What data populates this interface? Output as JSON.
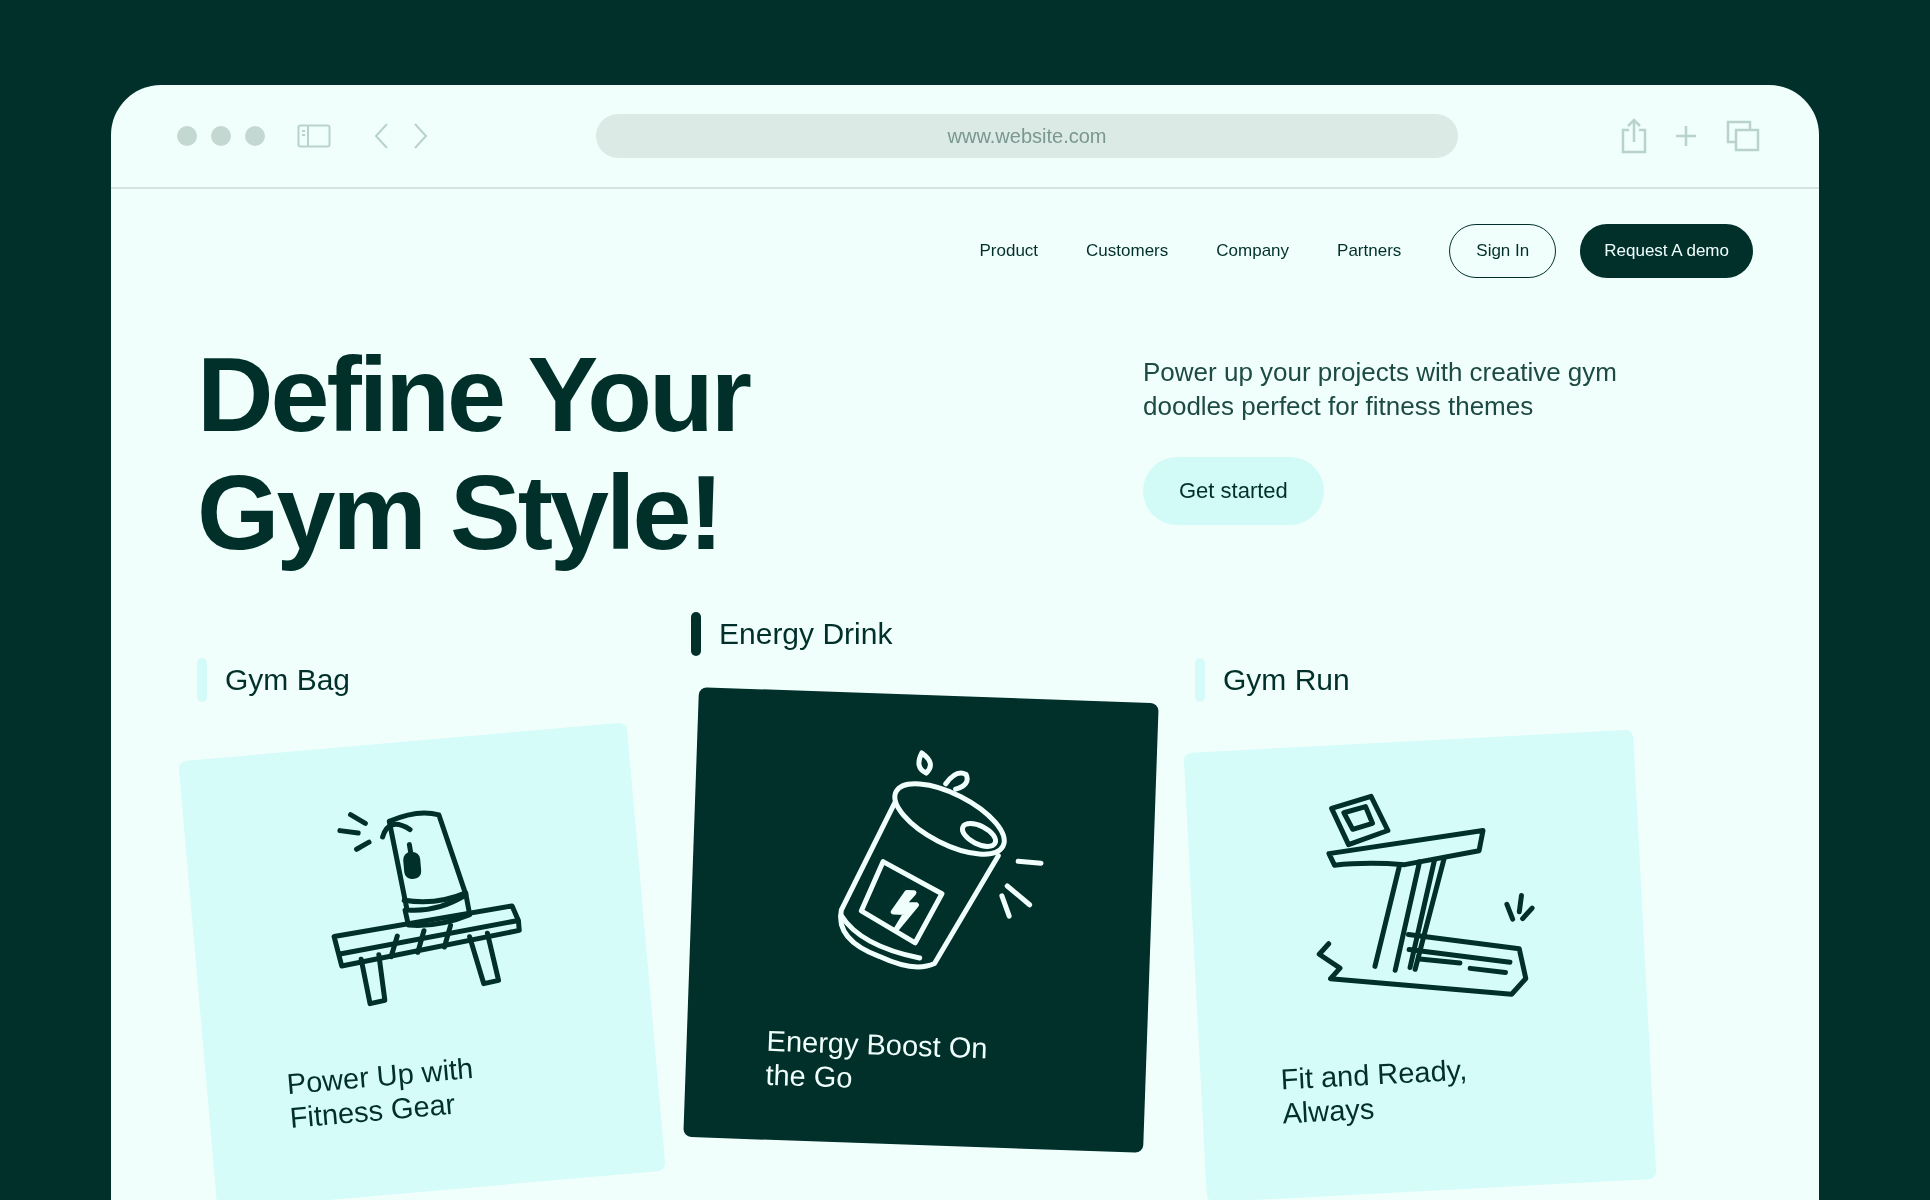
{
  "browser": {
    "url": "www.website.com"
  },
  "nav": {
    "links": [
      "Product",
      "Customers",
      "Company",
      "Partners"
    ],
    "sign_in": "Sign In",
    "cta": "Request A demo"
  },
  "hero": {
    "title_lines": [
      "Define Your",
      "Gym Style!"
    ],
    "description": "Power up your projects with creative gym doodles perfect for fitness themes",
    "button": "Get started"
  },
  "cards": [
    {
      "kind": "bag",
      "label": "Gym Bag",
      "caption": "Power Up with Fitness Gear",
      "selected": false
    },
    {
      "kind": "can",
      "label": "Energy Drink",
      "caption": "Energy Boost On the Go",
      "selected": true
    },
    {
      "kind": "treadmill",
      "label": "Gym Run",
      "caption": "Fit and Ready, Always",
      "selected": false
    }
  ]
}
